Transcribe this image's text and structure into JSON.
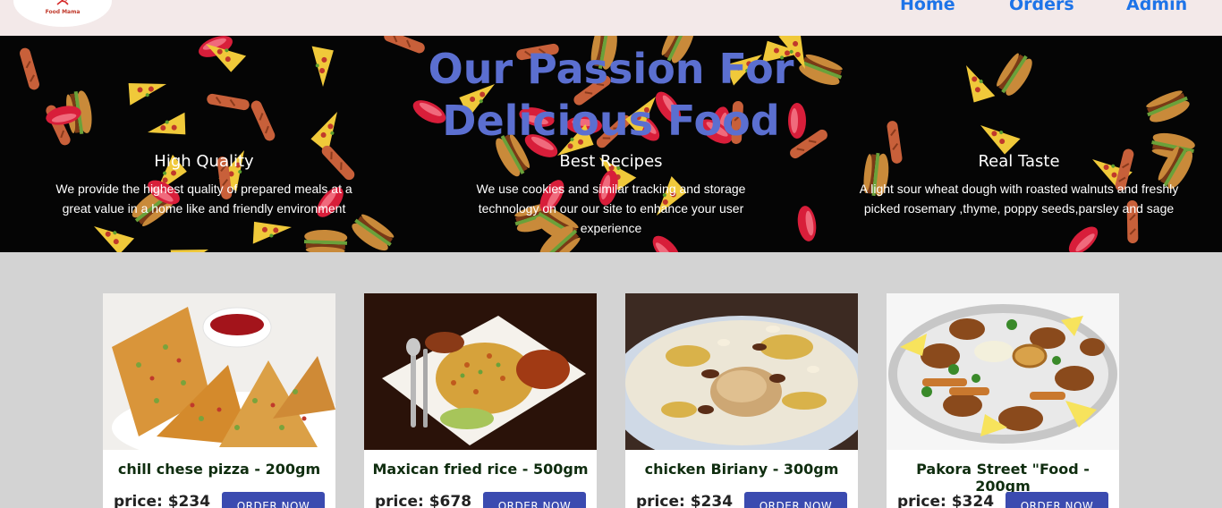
{
  "navbar": {
    "logo_text": "Food Mama",
    "links": [
      {
        "label": "Home"
      },
      {
        "label": "Orders"
      },
      {
        "label": "Admin"
      }
    ]
  },
  "hero": {
    "title": "Our Passion For Delicious Food",
    "features": [
      {
        "title": "High Quality",
        "text": "We provide the highest quality of prepared meals at a great value in a home like and friendly environment"
      },
      {
        "title": "Best Recipes",
        "text": "We use cookies and similar tracking and storage technology on our our site to enhance your user experience"
      },
      {
        "title": "Real Taste",
        "text": "A light sour wheat dough with roasted walnuts and freshly picked rosemary ,thyme, poppy seeds,parsley and sage"
      }
    ]
  },
  "products": [
    {
      "name": "chill chese pizza - 200gm",
      "price": "price: $234",
      "button": "ORDER NOW"
    },
    {
      "name": "Maxican fried rice - 500gm",
      "price": "price: $678",
      "button": "ORDER NOW"
    },
    {
      "name": "chicken Biriany - 300gm",
      "price": "price: $234",
      "button": "ORDER NOW"
    },
    {
      "name": "Pakora Street \"Food - 200gm",
      "price": "price: $324",
      "button": "ORDER NOW"
    }
  ],
  "colors": {
    "nav_bg": "#f3e9e9",
    "nav_link": "#1e74e8",
    "hero_title": "#5b6fd0",
    "page_bg": "#d3d3d3",
    "button_bg": "#3b4bb0"
  }
}
